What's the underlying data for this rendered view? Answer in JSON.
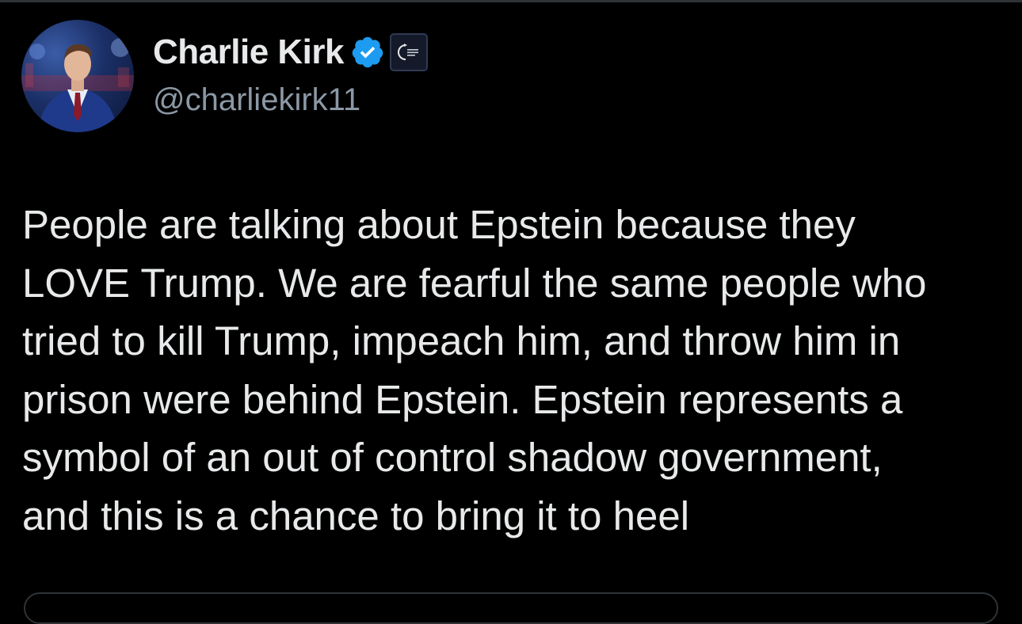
{
  "author": {
    "display_name": "Charlie Kirk",
    "handle": "@charliekirk11",
    "verified": true,
    "verified_color": "#1d9bf0",
    "affiliate_badge_icon": "turning-point-usa-logo"
  },
  "tweet": {
    "lines": [
      "People are talking about Epstein because they",
      "LOVE Trump. We are fearful the same people who",
      "tried to kill Trump, impeach him, and throw him in",
      "prison were behind Epstein. Epstein represents a",
      "symbol of an out of control shadow government,",
      "and this is a chance to bring it to heel"
    ]
  },
  "theme": {
    "background": "#000000",
    "text": "#e7e9ea",
    "secondary_text": "#8b98a5",
    "border": "#2f3336"
  }
}
